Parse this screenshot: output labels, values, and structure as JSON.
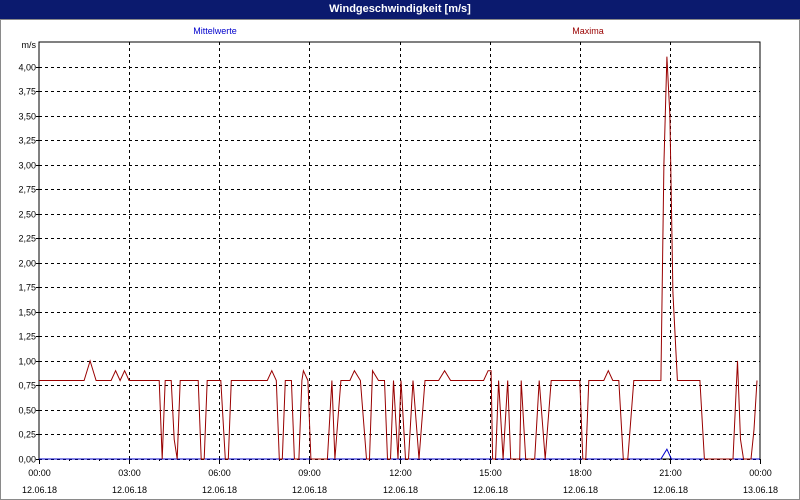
{
  "window": {
    "title": "Windgeschwindigkeit [m/s]"
  },
  "chart_data": {
    "type": "line",
    "title": "Windgeschwindigkeit [m/s]",
    "ylabel": "m/s",
    "ylim": [
      0,
      4.25
    ],
    "yticks": [
      "0,00",
      "0,25",
      "0,50",
      "0,75",
      "1,00",
      "1,25",
      "1,50",
      "1,75",
      "2,00",
      "2,25",
      "2,50",
      "2,75",
      "3,00",
      "3,25",
      "3,50",
      "3,75",
      "4,00"
    ],
    "xlim_hours": [
      0,
      24
    ],
    "xticks": [
      {
        "time": "00:00",
        "date": "12.06.18"
      },
      {
        "time": "03:00",
        "date": "12.06.18"
      },
      {
        "time": "06:00",
        "date": "12.06.18"
      },
      {
        "time": "09:00",
        "date": "12.06.18"
      },
      {
        "time": "12:00",
        "date": "12.06.18"
      },
      {
        "time": "15:00",
        "date": "12.06.18"
      },
      {
        "time": "18:00",
        "date": "12.06.18"
      },
      {
        "time": "21:00",
        "date": "12.06.18"
      },
      {
        "time": "00:00",
        "date": "13.06.18"
      }
    ],
    "grid": true,
    "series": [
      {
        "name": "Mittelwerte",
        "color": "#0000cc",
        "points": [
          [
            0,
            0
          ],
          [
            20.7,
            0
          ],
          [
            20.9,
            0.1
          ],
          [
            21.05,
            0
          ],
          [
            24,
            0
          ]
        ]
      },
      {
        "name": "Maxima",
        "color": "#990000",
        "points": [
          [
            0,
            0.8
          ],
          [
            1.5,
            0.8
          ],
          [
            1.7,
            1.0
          ],
          [
            1.9,
            0.8
          ],
          [
            2.4,
            0.8
          ],
          [
            2.55,
            0.9
          ],
          [
            2.7,
            0.8
          ],
          [
            2.85,
            0.9
          ],
          [
            3.0,
            0.8
          ],
          [
            4.0,
            0.8
          ],
          [
            4.1,
            0
          ],
          [
            4.2,
            0.8
          ],
          [
            4.4,
            0.8
          ],
          [
            4.5,
            0.2
          ],
          [
            4.6,
            0
          ],
          [
            4.7,
            0.8
          ],
          [
            5.3,
            0.8
          ],
          [
            5.4,
            0
          ],
          [
            5.5,
            0
          ],
          [
            5.6,
            0.8
          ],
          [
            6.05,
            0.8
          ],
          [
            6.2,
            0
          ],
          [
            6.3,
            0
          ],
          [
            6.4,
            0.8
          ],
          [
            7.6,
            0.8
          ],
          [
            7.75,
            0.9
          ],
          [
            7.9,
            0.8
          ],
          [
            8.0,
            0
          ],
          [
            8.1,
            0
          ],
          [
            8.2,
            0.8
          ],
          [
            8.4,
            0.8
          ],
          [
            8.5,
            0
          ],
          [
            8.65,
            0
          ],
          [
            8.75,
            0.8
          ],
          [
            8.8,
            0.9
          ],
          [
            8.95,
            0.8
          ],
          [
            9.05,
            0
          ],
          [
            9.15,
            0
          ],
          [
            9.3,
            0
          ],
          [
            9.6,
            0
          ],
          [
            9.75,
            0.8
          ],
          [
            9.85,
            0
          ],
          [
            10.05,
            0.8
          ],
          [
            10.35,
            0.8
          ],
          [
            10.5,
            0.9
          ],
          [
            10.7,
            0.8
          ],
          [
            10.9,
            0
          ],
          [
            11.0,
            0
          ],
          [
            11.1,
            0.9
          ],
          [
            11.3,
            0.8
          ],
          [
            11.5,
            0.8
          ],
          [
            11.6,
            0
          ],
          [
            11.7,
            0
          ],
          [
            11.8,
            0.8
          ],
          [
            11.95,
            0
          ],
          [
            12.05,
            0.8
          ],
          [
            12.2,
            0
          ],
          [
            12.3,
            0
          ],
          [
            12.45,
            0.8
          ],
          [
            12.65,
            0
          ],
          [
            12.85,
            0.8
          ],
          [
            13.3,
            0.8
          ],
          [
            13.5,
            0.9
          ],
          [
            13.7,
            0.8
          ],
          [
            14.8,
            0.8
          ],
          [
            14.95,
            0.9
          ],
          [
            15.05,
            0.9
          ],
          [
            15.1,
            0
          ],
          [
            15.2,
            0
          ],
          [
            15.3,
            0.8
          ],
          [
            15.45,
            0
          ],
          [
            15.6,
            0.8
          ],
          [
            15.7,
            0
          ],
          [
            16.0,
            0
          ],
          [
            16.05,
            0.8
          ],
          [
            16.2,
            0
          ],
          [
            16.5,
            0
          ],
          [
            16.65,
            0.8
          ],
          [
            16.85,
            0
          ],
          [
            17.05,
            0.8
          ],
          [
            17.3,
            0.8
          ],
          [
            17.55,
            0.8
          ],
          [
            17.75,
            0.8
          ],
          [
            18.0,
            0.8
          ],
          [
            18.1,
            0
          ],
          [
            18.2,
            0
          ],
          [
            18.3,
            0.8
          ],
          [
            18.8,
            0.8
          ],
          [
            18.95,
            0.9
          ],
          [
            19.1,
            0.8
          ],
          [
            19.3,
            0.8
          ],
          [
            19.45,
            0
          ],
          [
            19.6,
            0
          ],
          [
            19.8,
            0.8
          ],
          [
            20.7,
            0.8
          ],
          [
            20.8,
            3.0
          ],
          [
            20.9,
            4.1
          ],
          [
            21.0,
            3.5
          ],
          [
            21.1,
            1.7
          ],
          [
            21.25,
            0.8
          ],
          [
            22.0,
            0.8
          ],
          [
            22.15,
            0
          ],
          [
            22.35,
            0
          ],
          [
            22.9,
            0
          ],
          [
            23.1,
            0
          ],
          [
            23.25,
            1.0
          ],
          [
            23.35,
            0.2
          ],
          [
            23.45,
            0
          ],
          [
            23.7,
            0
          ],
          [
            23.8,
            0.3
          ],
          [
            23.9,
            0.8
          ]
        ]
      }
    ]
  }
}
